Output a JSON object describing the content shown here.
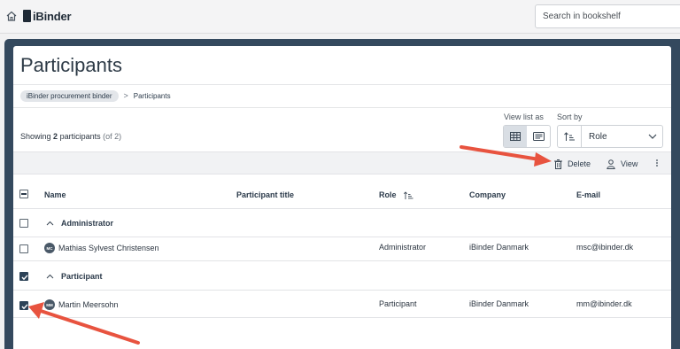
{
  "app": {
    "logo_text": "iBinder"
  },
  "search": {
    "placeholder": "Search in bookshelf"
  },
  "page": {
    "title": "Participants"
  },
  "breadcrumb": {
    "parent": "iBinder procurement binder",
    "separator": ">",
    "current": "Participants"
  },
  "summary": {
    "prefix": "Showing",
    "count": "2",
    "noun": "participants",
    "total": "(of 2)"
  },
  "view_controls": {
    "view_label": "View list as",
    "sort_label": "Sort by",
    "sort_value": "Role",
    "active_view": "grid"
  },
  "toolbar": {
    "delete_label": "Delete",
    "view_label": "View"
  },
  "table": {
    "columns": [
      "Name",
      "Participant title",
      "Role",
      "Company",
      "E-mail"
    ],
    "groups": [
      {
        "label": "Administrator",
        "checked": false,
        "rows": [
          {
            "initials": "MC",
            "name": "Mathias Sylvest Christensen",
            "title": "",
            "role": "Administrator",
            "company": "iBinder Danmark",
            "email": "msc@ibinder.dk",
            "checked": false
          }
        ]
      },
      {
        "label": "Participant",
        "checked": true,
        "rows": [
          {
            "initials": "MM",
            "name": "Martin Meersohn",
            "title": "",
            "role": "Participant",
            "company": "iBinder Danmark",
            "email": "mm@ibinder.dk",
            "checked": true
          }
        ]
      }
    ]
  },
  "colors": {
    "frame": "#34495e",
    "annotation_arrow": "#e8533f",
    "checkbox_checked": "#2c4257"
  }
}
